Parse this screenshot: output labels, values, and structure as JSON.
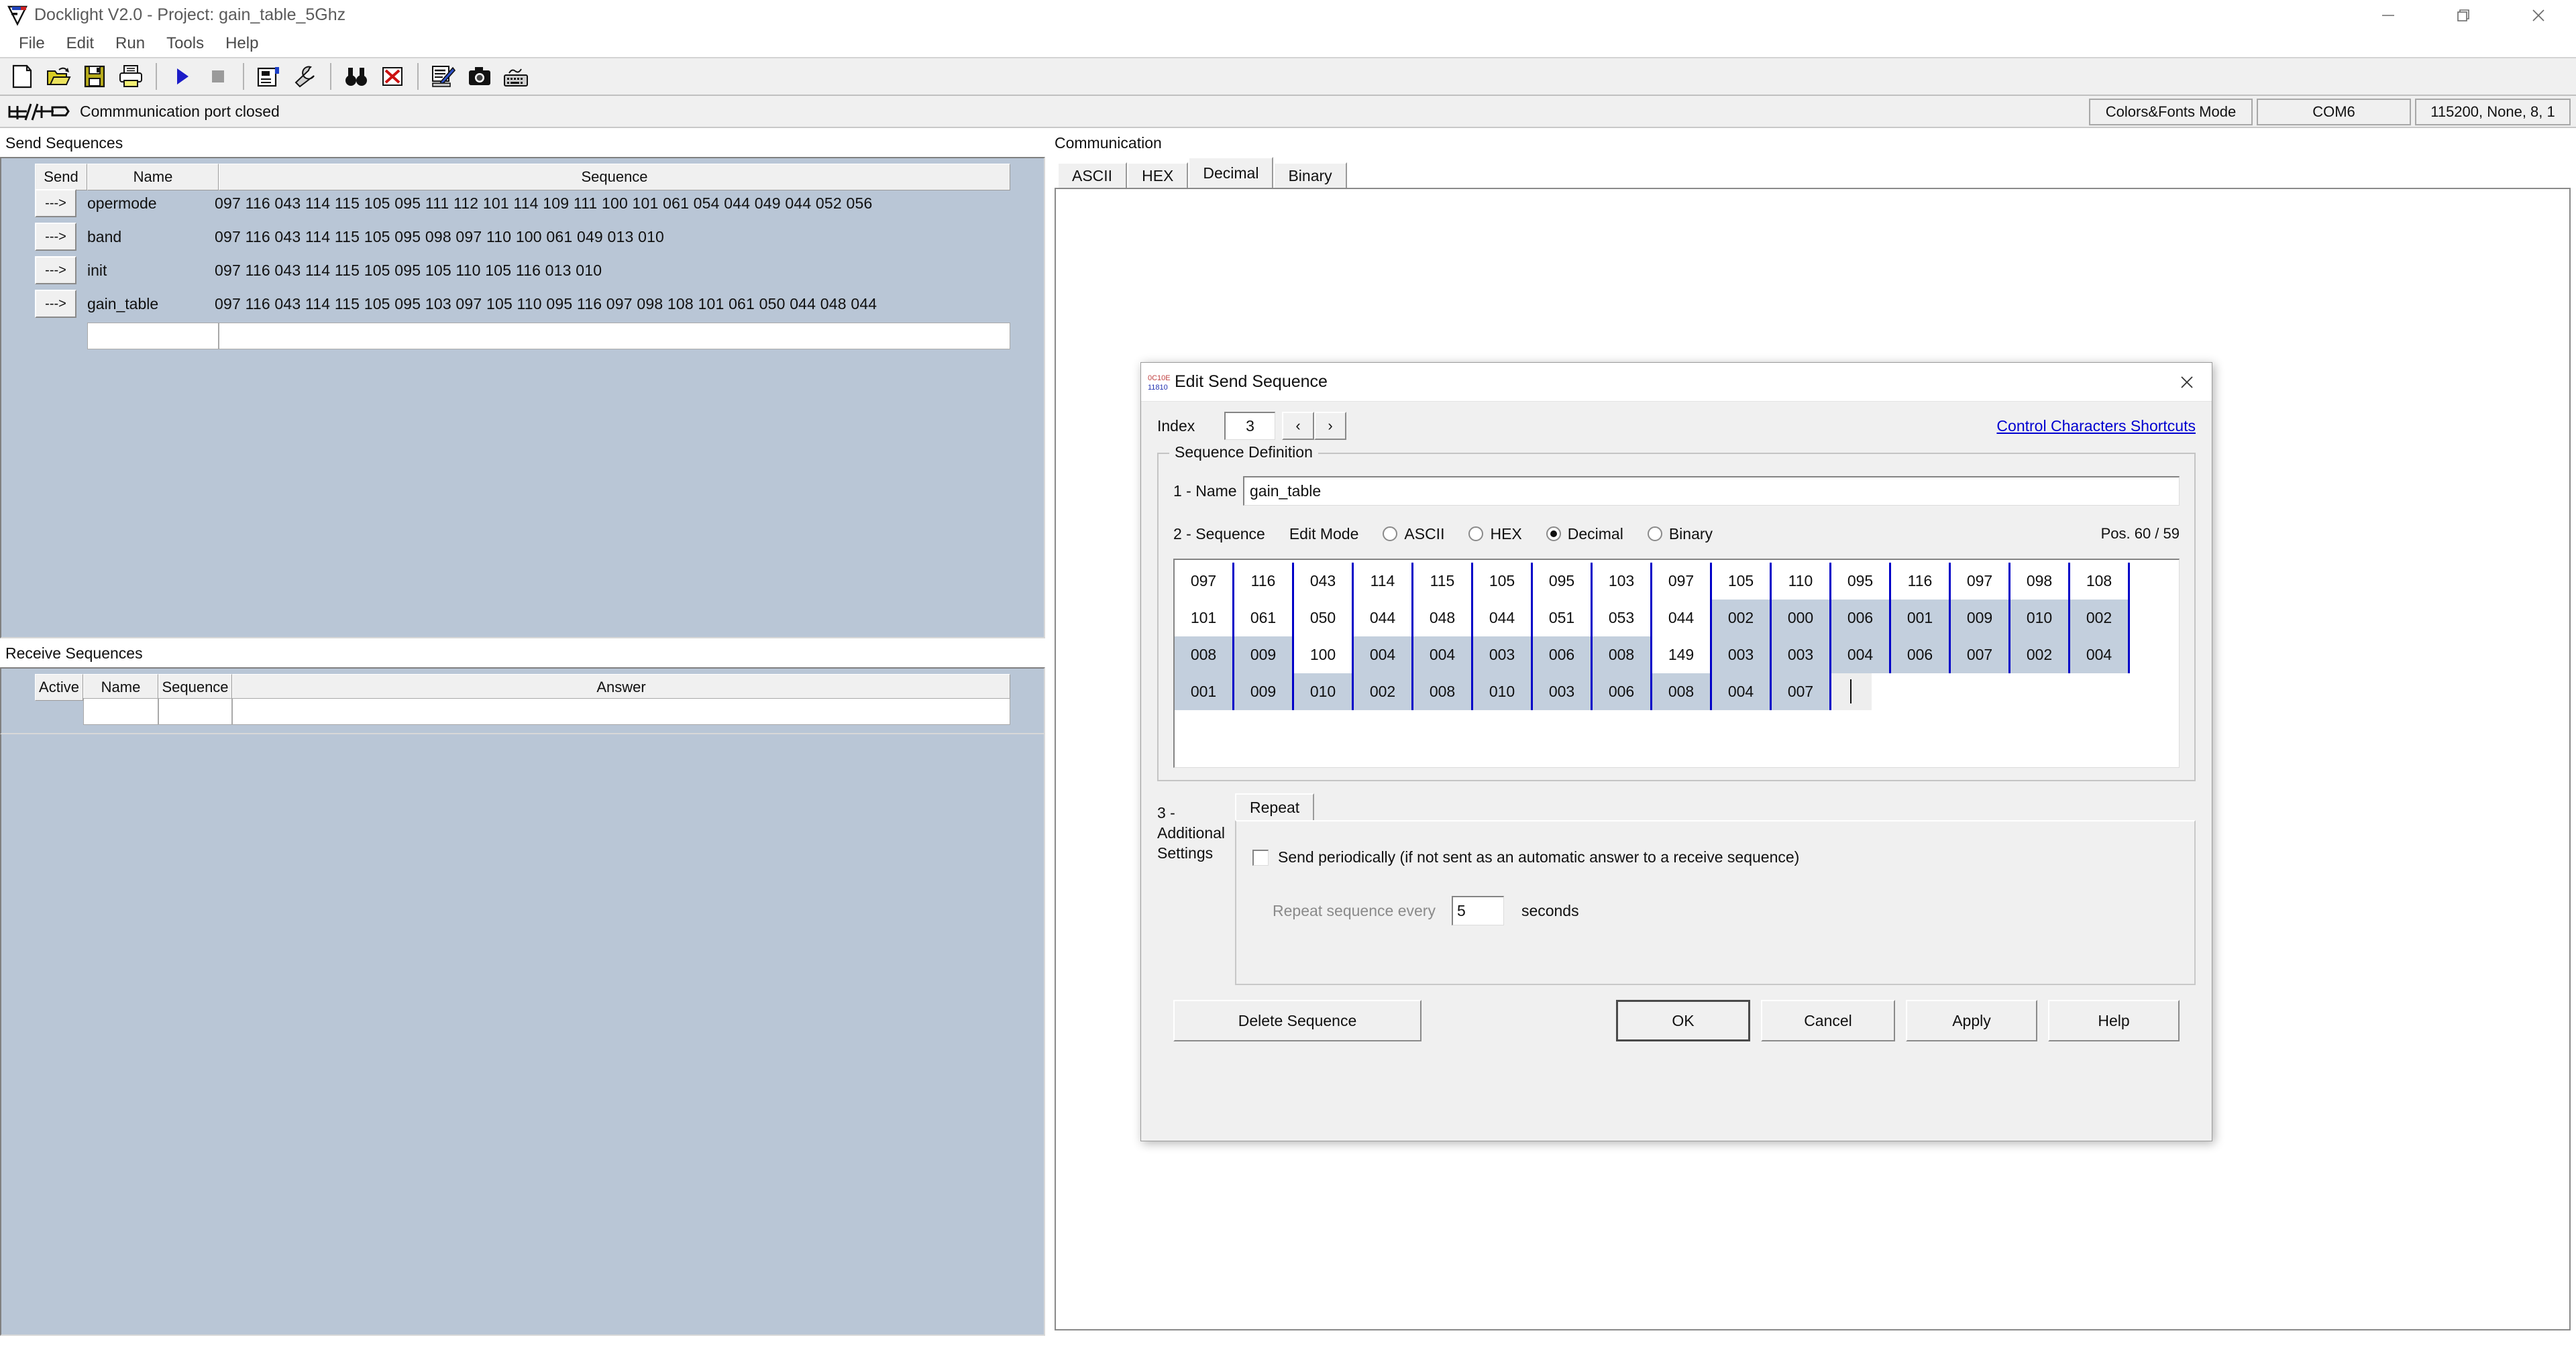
{
  "window": {
    "title": "Docklight V2.0 - Project: gain_table_5Ghz",
    "logo_icon": "docklight-logo-icon",
    "minimize_icon": "minimize-icon",
    "maximize_icon": "maximize-icon",
    "close_icon": "close-icon"
  },
  "menu": {
    "items": [
      {
        "label": "File"
      },
      {
        "label": "Edit"
      },
      {
        "label": "Run"
      },
      {
        "label": "Tools"
      },
      {
        "label": "Help"
      }
    ]
  },
  "toolbar": {
    "buttons": [
      {
        "name": "new-file-icon"
      },
      {
        "name": "open-file-icon"
      },
      {
        "name": "save-file-icon"
      },
      {
        "name": "print-icon"
      },
      {
        "name": "start-communication-icon"
      },
      {
        "name": "stop-communication-icon"
      },
      {
        "name": "project-settings-icon"
      },
      {
        "name": "tools-wrench-icon"
      },
      {
        "name": "find-binoculars-icon"
      },
      {
        "name": "clear-delete-icon"
      },
      {
        "name": "edit-report-icon"
      },
      {
        "name": "snapshot-camera-icon"
      },
      {
        "name": "keyboard-console-icon"
      }
    ]
  },
  "portbar": {
    "icon": "serial-port-disconnected-icon",
    "status_text": "Commmunication port closed",
    "fields": [
      {
        "label": "Colors&Fonts Mode"
      },
      {
        "label": "COM6"
      },
      {
        "label": "115200, None, 8, 1"
      }
    ]
  },
  "send_sequences": {
    "panel_label": "Send Sequences",
    "columns": [
      "Send",
      "Name",
      "Sequence"
    ],
    "rows": [
      {
        "send_label": "--->",
        "name": "opermode",
        "sequence": "097 116 043 114 115 105 095 111 112 101 114 109 111 100 101 061 054 044 049 044 052 056"
      },
      {
        "send_label": "--->",
        "name": "band",
        "sequence": "097 116 043 114 115 105 095 098 097 110 100 061 049 013 010"
      },
      {
        "send_label": "--->",
        "name": "init",
        "sequence": "097 116 043 114 115 105 095 105 110 105 116 013 010"
      },
      {
        "send_label": "--->",
        "name": "gain_table",
        "sequence": "097 116 043 114 115 105 095 103 097 105 110 095 116 097 098 108 101 061 050 044 048 044"
      }
    ]
  },
  "receive_sequences": {
    "panel_label": "Receive Sequences",
    "columns": [
      "Active",
      "Name",
      "Sequence",
      "Answer"
    ]
  },
  "communication": {
    "panel_label": "Communication",
    "tabs": [
      {
        "label": "ASCII",
        "active": false
      },
      {
        "label": "HEX",
        "active": false
      },
      {
        "label": "Decimal",
        "active": true
      },
      {
        "label": "Binary",
        "active": false
      }
    ]
  },
  "dialog": {
    "icon": "sequence-bytes-icon",
    "title": "Edit Send Sequence",
    "close_icon": "close-icon",
    "index_label": "Index",
    "index_value": "3",
    "prev_arrow": "‹",
    "next_arrow": "›",
    "shortcuts_link": "Control Characters Shortcuts",
    "group_title": "Sequence Definition",
    "name_label": "1 - Name",
    "name_value": "gain_table",
    "sequence_label": "2 - Sequence",
    "edit_mode_label": "Edit Mode",
    "edit_modes": [
      {
        "label": "ASCII",
        "selected": false
      },
      {
        "label": "HEX",
        "selected": false
      },
      {
        "label": "Decimal",
        "selected": true
      },
      {
        "label": "Binary",
        "selected": false
      }
    ],
    "pos_label": "Pos. 60 / 59",
    "byte_rows": [
      [
        {
          "v": "097",
          "sel": false
        },
        {
          "v": "116",
          "sel": false
        },
        {
          "v": "043",
          "sel": false
        },
        {
          "v": "114",
          "sel": false
        },
        {
          "v": "115",
          "sel": false
        },
        {
          "v": "105",
          "sel": false
        },
        {
          "v": "095",
          "sel": false
        },
        {
          "v": "103",
          "sel": false
        },
        {
          "v": "097",
          "sel": false
        },
        {
          "v": "105",
          "sel": false
        },
        {
          "v": "110",
          "sel": false
        },
        {
          "v": "095",
          "sel": false
        },
        {
          "v": "116",
          "sel": false
        },
        {
          "v": "097",
          "sel": false
        },
        {
          "v": "098",
          "sel": false
        },
        {
          "v": "108",
          "sel": false
        }
      ],
      [
        {
          "v": "101",
          "sel": false
        },
        {
          "v": "061",
          "sel": false
        },
        {
          "v": "050",
          "sel": false
        },
        {
          "v": "044",
          "sel": false
        },
        {
          "v": "048",
          "sel": false
        },
        {
          "v": "044",
          "sel": false
        },
        {
          "v": "051",
          "sel": false
        },
        {
          "v": "053",
          "sel": false
        },
        {
          "v": "044",
          "sel": false
        },
        {
          "v": "002",
          "sel": true
        },
        {
          "v": "000",
          "sel": true
        },
        {
          "v": "006",
          "sel": true
        },
        {
          "v": "001",
          "sel": true
        },
        {
          "v": "009",
          "sel": true
        },
        {
          "v": "010",
          "sel": true
        },
        {
          "v": "002",
          "sel": true
        }
      ],
      [
        {
          "v": "008",
          "sel": true
        },
        {
          "v": "009",
          "sel": true
        },
        {
          "v": "100",
          "sel": false
        },
        {
          "v": "004",
          "sel": true
        },
        {
          "v": "004",
          "sel": true
        },
        {
          "v": "003",
          "sel": true
        },
        {
          "v": "006",
          "sel": true
        },
        {
          "v": "008",
          "sel": true
        },
        {
          "v": "149",
          "sel": false
        },
        {
          "v": "003",
          "sel": true
        },
        {
          "v": "003",
          "sel": true
        },
        {
          "v": "004",
          "sel": true
        },
        {
          "v": "006",
          "sel": true
        },
        {
          "v": "007",
          "sel": true
        },
        {
          "v": "002",
          "sel": true
        },
        {
          "v": "004",
          "sel": true
        }
      ],
      [
        {
          "v": "001",
          "sel": true
        },
        {
          "v": "009",
          "sel": true
        },
        {
          "v": "010",
          "sel": true
        },
        {
          "v": "002",
          "sel": true
        },
        {
          "v": "008",
          "sel": true
        },
        {
          "v": "010",
          "sel": true
        },
        {
          "v": "003",
          "sel": true
        },
        {
          "v": "006",
          "sel": true
        },
        {
          "v": "008",
          "sel": true
        },
        {
          "v": "004",
          "sel": true
        },
        {
          "v": "007",
          "sel": true
        }
      ]
    ],
    "additional_settings_label": "3 - Additional\nSettings",
    "additional_settings_line1": "3 - Additional",
    "additional_settings_line2": "Settings",
    "repeat_tab_label": "Repeat",
    "send_periodically_label": "Send periodically  (if not sent as an automatic answer to a receive sequence)",
    "send_periodically_checked": false,
    "repeat_every_label": "Repeat sequence every",
    "repeat_every_value": "5",
    "repeat_unit_label": "seconds",
    "buttons": {
      "delete": "Delete Sequence",
      "ok": "OK",
      "cancel": "Cancel",
      "apply": "Apply",
      "help": "Help"
    }
  }
}
